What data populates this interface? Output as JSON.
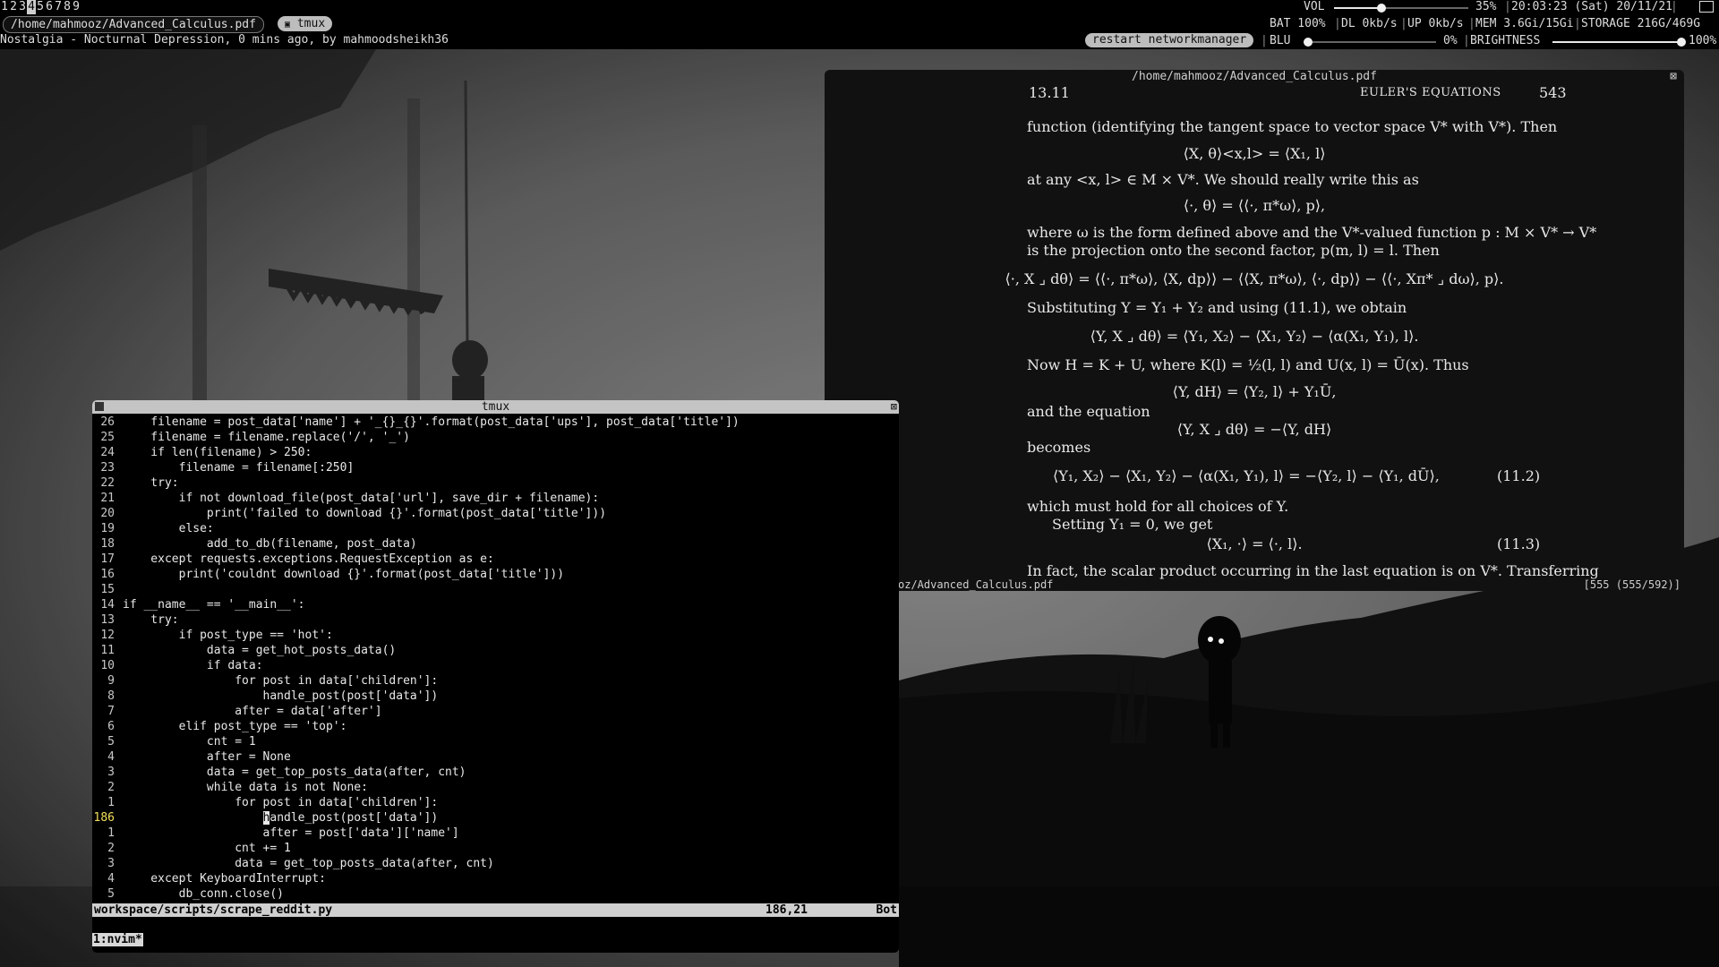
{
  "topbar": {
    "workspaces": [
      "1",
      "2",
      "3",
      "4",
      "5",
      "6",
      "7",
      "8",
      "9"
    ],
    "active_workspace": "4",
    "window_tab": "/home/mahmooz/Advanced_Calculus.pdf",
    "tmux_tab": "tmux",
    "now_playing": "Nostalgia - Nocturnal Depression, 0 mins ago, by mahmoodsheikh36",
    "vol_label": "VOL",
    "vol_value": "35%",
    "vol_fraction": 0.35,
    "datetime": "20:03:23 (Sat) 20/11/21",
    "bat": "BAT 100%",
    "dl": "DL 0kb/s",
    "up": "UP 0kb/s",
    "mem": "MEM 3.6Gi/15Gi",
    "storage": "STORAGE 216G/469G",
    "restart_button": "restart networkmanager",
    "blu_label": "BLU",
    "blu_value": "0%",
    "blu_fraction": 0.0,
    "brightness_label": "BRIGHTNESS",
    "brightness_value": "100%",
    "brightness_fraction": 1.0
  },
  "pdf": {
    "window_title": "/home/mahmooz/Advanced_Calculus.pdf",
    "close_icon": "close-icon",
    "section": "13.11",
    "running_head": "EULER'S EQUATIONS",
    "page_number": "543",
    "lines": [
      "function (identifying the tangent space to vector space V* with V*).  Then",
      "⟨X, θ⟩<x,l> = ⟨X₁, l⟩",
      "at any <x, l> ∈ M × V*.  We should really write this as",
      "⟨·, θ⟩ = ⟨⟨·, π*ω⟩, p⟩,",
      "where ω is the form defined above and the V*-valued function p : M × V* → V*",
      "is the projection onto the second factor, p(m, l) = l.  Then",
      "⟨·, X ⌟ dθ⟩ = ⟨⟨·, π*ω⟩, ⟨X, dp⟩⟩ − ⟨⟨X, π*ω⟩, ⟨·, dp⟩⟩ − ⟨⟨·, Xπ* ⌟ dω⟩, p⟩.",
      "Substituting Y = Y₁ + Y₂ and using (11.1), we obtain",
      "⟨Y, X ⌟ dθ⟩ = ⟨Y₁, X₂⟩ − ⟨X₁, Y₂⟩ − ⟨α(X₁, Y₁), l⟩.",
      "Now H = K + U, where K(l) = ½(l, l) and U(x, l) = Ū(x).  Thus",
      "⟨Y, dH⟩ = ⟨Y₂, l⟩ + Y₁Ū,",
      "and the equation",
      "⟨Y, X ⌟ dθ⟩ = −⟨Y, dH⟩",
      "becomes",
      "⟨Y₁, X₂⟩ − ⟨X₁, Y₂⟩ − ⟨α(X₁, Y₁), l⟩ = −⟨Y₂, l⟩ − ⟨Y₁, dŪ⟩,",
      "which must hold for all choices of Y.",
      "Setting Y₁ = 0, we get",
      "⟨X₁, ·⟩ = ⟨·, l⟩.",
      "In fact, the scalar product occurring in the last equation is on V*.  Transferring"
    ],
    "eq_112": "(11.2)",
    "eq_113": "(11.3)",
    "status_path": "oz/Advanced_Calculus.pdf",
    "status_page": "[555 (555/592)]"
  },
  "tmux": {
    "window_title": "tmux",
    "code_lines": [
      {
        "n": "26",
        "t": "    filename = post_data['name'] + '_{}_{}'.format(post_data['ups'], post_data['title'])"
      },
      {
        "n": "25",
        "t": "    filename = filename.replace('/', '_')"
      },
      {
        "n": "24",
        "t": "    if len(filename) > 250:"
      },
      {
        "n": "23",
        "t": "        filename = filename[:250]"
      },
      {
        "n": "22",
        "t": "    try:"
      },
      {
        "n": "21",
        "t": "        if not download_file(post_data['url'], save_dir + filename):"
      },
      {
        "n": "20",
        "t": "            print('failed to download {}'.format(post_data['title']))"
      },
      {
        "n": "19",
        "t": "        else:"
      },
      {
        "n": "18",
        "t": "            add_to_db(filename, post_data)"
      },
      {
        "n": "17",
        "t": "    except requests.exceptions.RequestException as e:"
      },
      {
        "n": "16",
        "t": "        print('couldnt download {}'.format(post_data['title']))"
      },
      {
        "n": "15",
        "t": ""
      },
      {
        "n": "14",
        "t": "if __name__ == '__main__':"
      },
      {
        "n": "13",
        "t": "    try:"
      },
      {
        "n": "12",
        "t": "        if post_type == 'hot':"
      },
      {
        "n": "11",
        "t": "            data = get_hot_posts_data()"
      },
      {
        "n": "10",
        "t": "            if data:"
      },
      {
        "n": "9",
        "t": "                for post in data['children']:"
      },
      {
        "n": "8",
        "t": "                    handle_post(post['data'])"
      },
      {
        "n": "7",
        "t": "                after = data['after']"
      },
      {
        "n": "6",
        "t": "        elif post_type == 'top':"
      },
      {
        "n": "5",
        "t": "            cnt = 1"
      },
      {
        "n": "4",
        "t": "            after = None"
      },
      {
        "n": "3",
        "t": "            data = get_top_posts_data(after, cnt)"
      },
      {
        "n": "2",
        "t": "            while data is not None:"
      },
      {
        "n": "1",
        "t": "                for post in data['children']:"
      },
      {
        "n": "186",
        "t": "                    handle_post(post['data'])",
        "current": true
      },
      {
        "n": "1",
        "t": "                    after = post['data']['name']"
      },
      {
        "n": "2",
        "t": "                cnt += 1"
      },
      {
        "n": "3",
        "t": "                data = get_top_posts_data(after, cnt)"
      },
      {
        "n": "4",
        "t": "    except KeyboardInterrupt:"
      },
      {
        "n": "5",
        "t": "        db_conn.close()"
      }
    ],
    "status_file": "workspace/scripts/scrape_reddit.py",
    "status_pos": "186,21",
    "status_pct": "Bot",
    "tmux_window": "1:nvim*"
  }
}
